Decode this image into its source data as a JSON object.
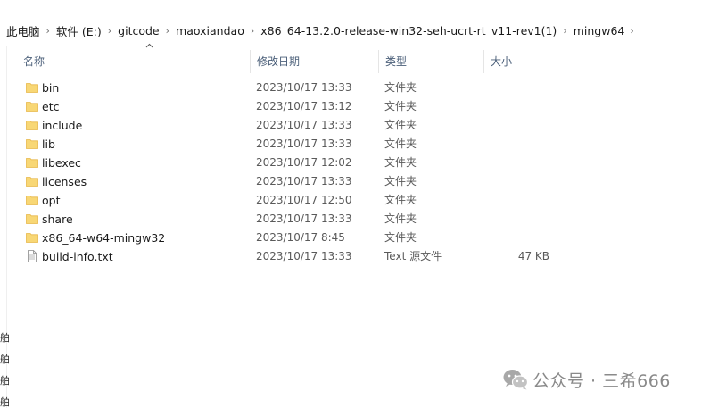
{
  "breadcrumb": {
    "items": [
      {
        "label": "此电脑"
      },
      {
        "label": "软件 (E:)"
      },
      {
        "label": "gitcode"
      },
      {
        "label": "maoxiandao"
      },
      {
        "label": "x86_64-13.2.0-release-win32-seh-ucrt-rt_v11-rev1(1)"
      },
      {
        "label": "mingw64"
      }
    ]
  },
  "columns": {
    "name": "名称",
    "modified": "修改日期",
    "type": "类型",
    "size": "大小"
  },
  "files": [
    {
      "name": "bin",
      "modified": "2023/10/17 13:33",
      "type": "文件夹",
      "size": "",
      "icon": "folder-icon"
    },
    {
      "name": "etc",
      "modified": "2023/10/17 13:12",
      "type": "文件夹",
      "size": "",
      "icon": "folder-icon"
    },
    {
      "name": "include",
      "modified": "2023/10/17 13:33",
      "type": "文件夹",
      "size": "",
      "icon": "folder-icon"
    },
    {
      "name": "lib",
      "modified": "2023/10/17 13:33",
      "type": "文件夹",
      "size": "",
      "icon": "folder-icon"
    },
    {
      "name": "libexec",
      "modified": "2023/10/17 12:02",
      "type": "文件夹",
      "size": "",
      "icon": "folder-icon"
    },
    {
      "name": "licenses",
      "modified": "2023/10/17 13:33",
      "type": "文件夹",
      "size": "",
      "icon": "folder-icon"
    },
    {
      "name": "opt",
      "modified": "2023/10/17 12:50",
      "type": "文件夹",
      "size": "",
      "icon": "folder-icon"
    },
    {
      "name": "share",
      "modified": "2023/10/17 13:33",
      "type": "文件夹",
      "size": "",
      "icon": "folder-icon"
    },
    {
      "name": "x86_64-w64-mingw32",
      "modified": "2023/10/17 8:45",
      "type": "文件夹",
      "size": "",
      "icon": "folder-icon"
    },
    {
      "name": "build-info.txt",
      "modified": "2023/10/17 13:33",
      "type": "Text 源文件",
      "size": "47 KB",
      "icon": "text-file-icon"
    }
  ],
  "gutter_chars": [
    "舶",
    "舶",
    "舶",
    "舶"
  ],
  "watermark": {
    "text": "公众号 · 三希666",
    "icon": "wechat-icon"
  },
  "colors": {
    "folder": "#f8d775",
    "folder_dark": "#e8b84a",
    "header_text": "#4c607a",
    "watermark": "#8a8a8a"
  }
}
